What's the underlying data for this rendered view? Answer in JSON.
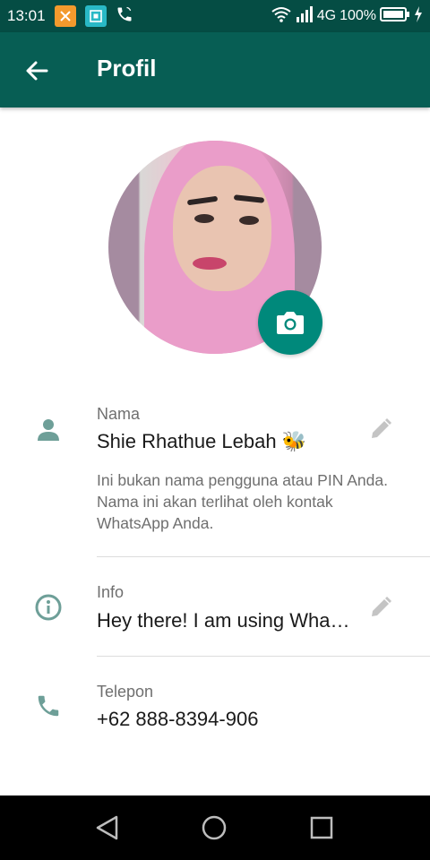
{
  "status_bar": {
    "time": "13:01",
    "network": "4G",
    "battery": "100%",
    "icons": [
      "notification-orange-icon",
      "notification-teal-icon",
      "phone-call-icon",
      "wifi-icon",
      "signal-icon",
      "battery-icon",
      "charging-icon"
    ]
  },
  "app_bar": {
    "title": "Profil",
    "back_icon": "arrow-back-icon",
    "color": "#075e54"
  },
  "profile": {
    "camera_icon": "camera-icon",
    "accent_color": "#00897b",
    "name_section": {
      "label": "Nama",
      "value": "Shie Rhathue Lebah 🐝",
      "icon": "person-icon",
      "edit_icon": "pencil-icon",
      "hint": "Ini bukan nama pengguna atau PIN Anda. Nama ini akan terlihat oleh kontak WhatsApp Anda."
    },
    "info_section": {
      "label": "Info",
      "value": "Hey there! I am using Wha…",
      "icon": "info-icon",
      "edit_icon": "pencil-icon"
    },
    "phone_section": {
      "label": "Telepon",
      "value": "+62 888-8394-906",
      "icon": "phone-icon"
    }
  },
  "nav_bar": {
    "icons": [
      "back-triangle-icon",
      "home-circle-icon",
      "recents-square-icon"
    ]
  }
}
